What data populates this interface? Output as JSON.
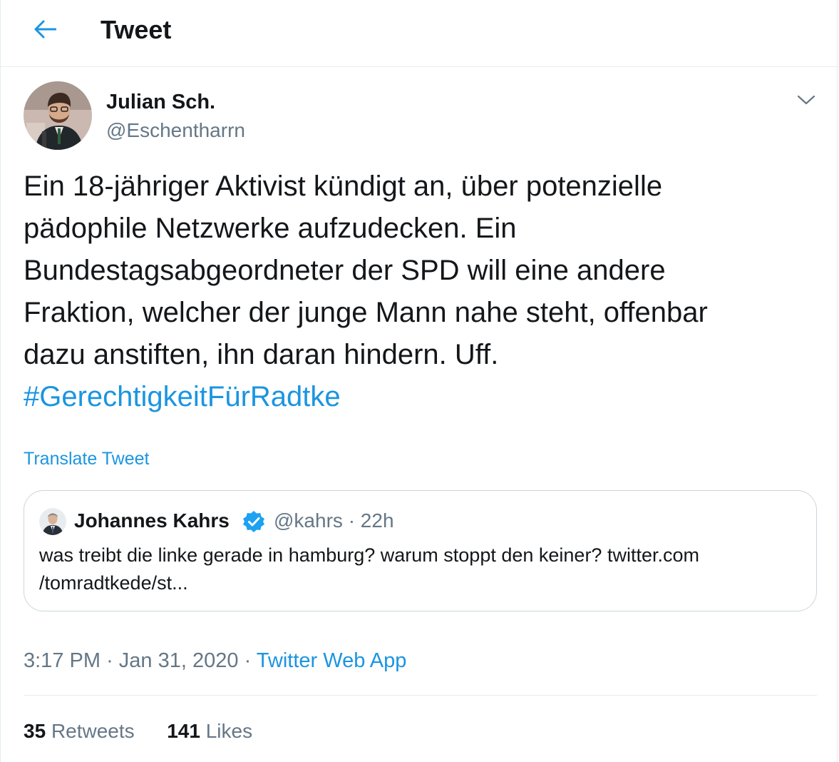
{
  "header": {
    "back_icon": "arrow-left-icon",
    "title": "Tweet"
  },
  "tweet": {
    "author": {
      "name": "Julian Sch.",
      "handle": "@Eschentharrn",
      "avatar_icon": "user-avatar"
    },
    "caret_icon": "chevron-down-icon",
    "text_lines": [
      "Ein 18-jähriger Aktivist kündigt an, über potenzielle",
      "pädophile Netzwerke aufzudecken. Ein",
      "Bundestagsabgeordneter der SPD will eine andere",
      "Fraktion, welcher der junge Mann nahe steht, offenbar",
      "dazu anstiften, ihn daran hindern. Uff."
    ],
    "hashtag": "#GerechtigkeitFürRadtke",
    "translate_label": "Translate Tweet",
    "quote": {
      "name": "Johannes Kahrs",
      "verified_icon": "verified-badge-icon",
      "handle": "@kahrs",
      "separator": "·",
      "time": "22h",
      "text_lines": [
        "was treibt die linke gerade in hamburg? warum stoppt den keiner? twitter.com",
        "/tomradtkede/st..."
      ]
    },
    "meta": {
      "time": "3:17 PM",
      "separator": "·",
      "date": "Jan 31, 2020",
      "app": "Twitter Web App"
    },
    "stats": {
      "retweets_count": "35",
      "retweets_label": "Retweets",
      "likes_count": "141",
      "likes_label": "Likes"
    }
  },
  "colors": {
    "accent": "#1b95e0",
    "secondary_text": "#657786",
    "primary_text": "#14171a",
    "border": "#e6ecf0"
  }
}
